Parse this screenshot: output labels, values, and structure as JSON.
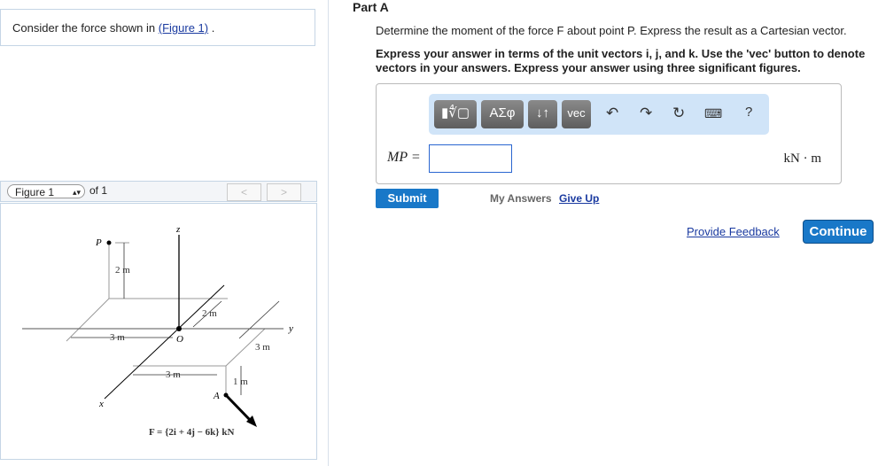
{
  "left": {
    "consider_text": "Consider the force shown in ",
    "figure_link": "(Figure 1)",
    "consider_end": " ."
  },
  "figure_nav": {
    "select": "Figure 1",
    "of": "of 1",
    "prev": "<",
    "next": ">"
  },
  "figure": {
    "z": "z",
    "y": "y",
    "x": "x",
    "P": "P",
    "O": "O",
    "A": "A",
    "d_2m_vert": "2 m",
    "d_2m": "2 m",
    "d_3m_left": "3 m",
    "d_3m_right": "3 m",
    "d_3m_lower": "3 m",
    "d_1m": "1 m",
    "force": "F = {2i + 4j − 6k} kN"
  },
  "part": {
    "title": "Part A",
    "question": "Determine the moment of the force F about point P. Express the result as a Cartesian vector.",
    "instructions": "Express your answer in terms of the unit vectors i, j, and k. Use the 'vec' button to denote vectors in your answers. Express your answer using three significant figures."
  },
  "toolbar": {
    "templates": "▮∜▢",
    "greek": "ΑΣφ",
    "arrows": "↓↑",
    "vec": "vec",
    "help": "?"
  },
  "answer": {
    "label": "MP =",
    "value": "",
    "unit": "kN · m"
  },
  "buttons": {
    "submit": "Submit",
    "my_answers": "My Answers",
    "give_up": "Give Up",
    "feedback": "Provide Feedback",
    "continue": "Continue"
  }
}
